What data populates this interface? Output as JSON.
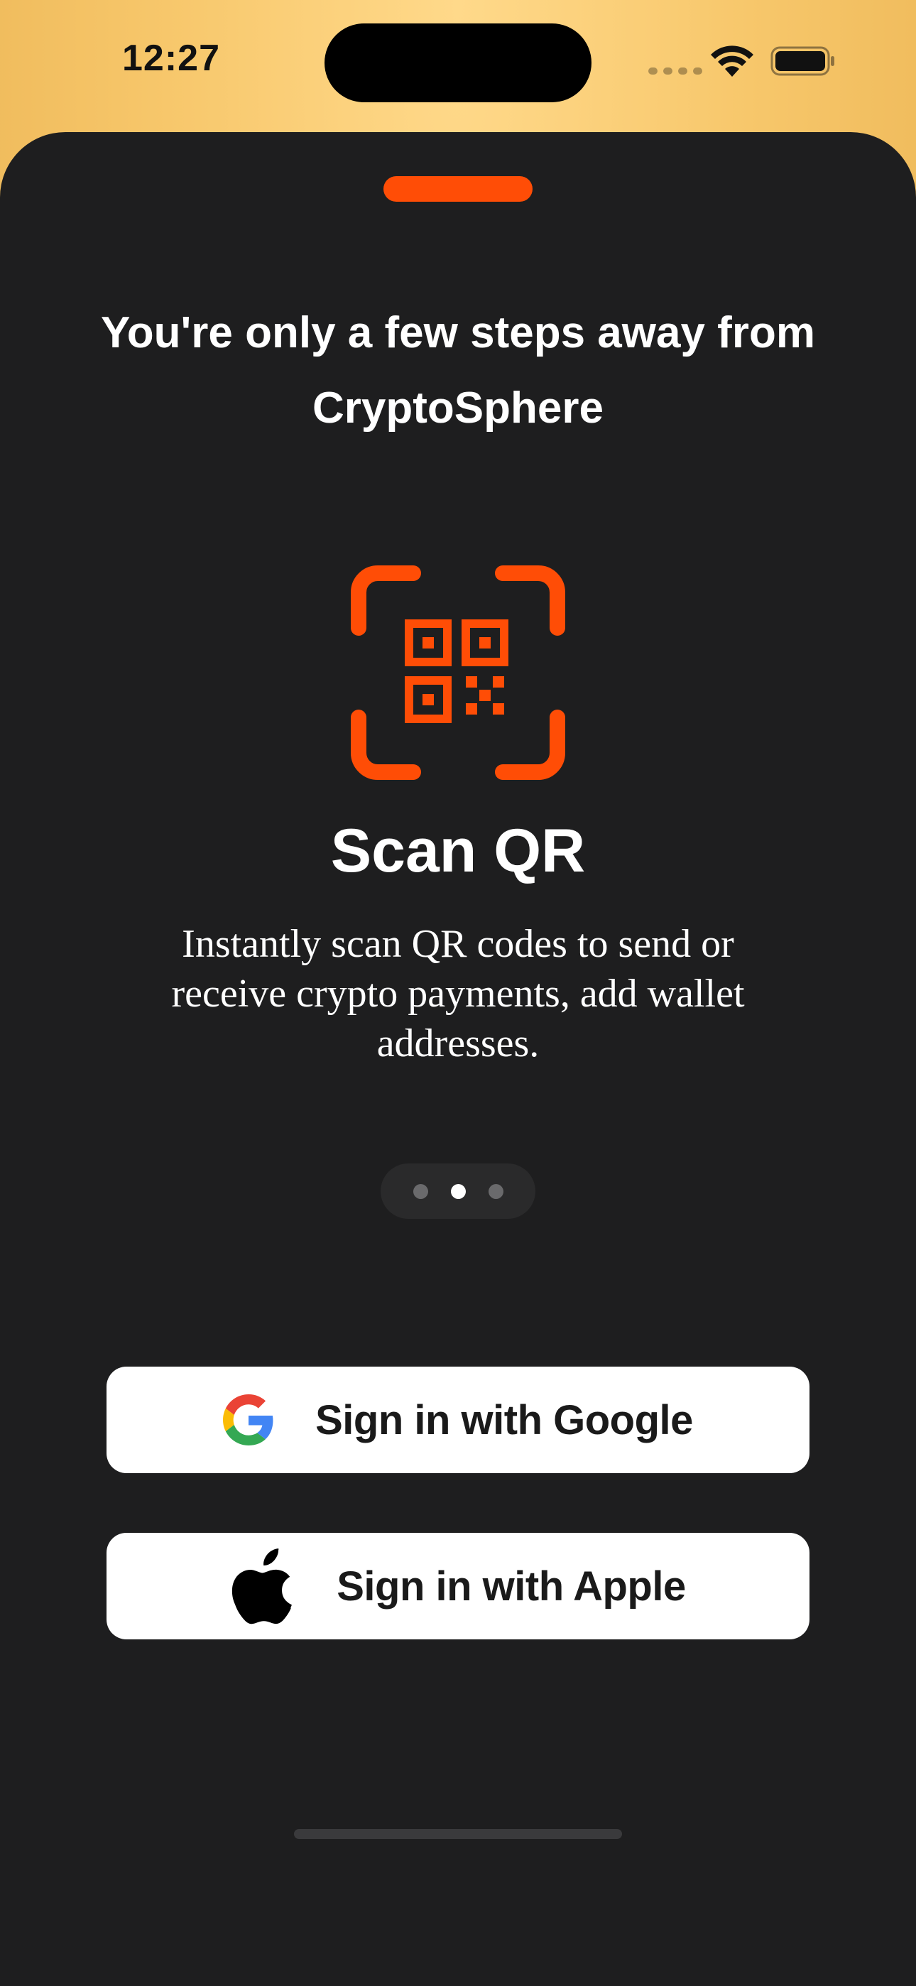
{
  "status_bar": {
    "time": "12:27"
  },
  "onboarding": {
    "headline": "You're only a few steps away from CryptoSphere",
    "feature": {
      "icon": "qr-scan-icon",
      "title": "Scan QR",
      "description": "Instantly scan QR codes to send or receive crypto payments, add wallet addresses."
    },
    "pager": {
      "total_pages": 3,
      "current_page": 2
    }
  },
  "auth": {
    "google_label": "Sign in with Google",
    "apple_label": "Sign in with Apple"
  },
  "colors": {
    "accent": "#ff4d06",
    "sheet_background": "#1e1e1f",
    "button_background": "#ffffff",
    "header_background": "#f7c76b"
  }
}
